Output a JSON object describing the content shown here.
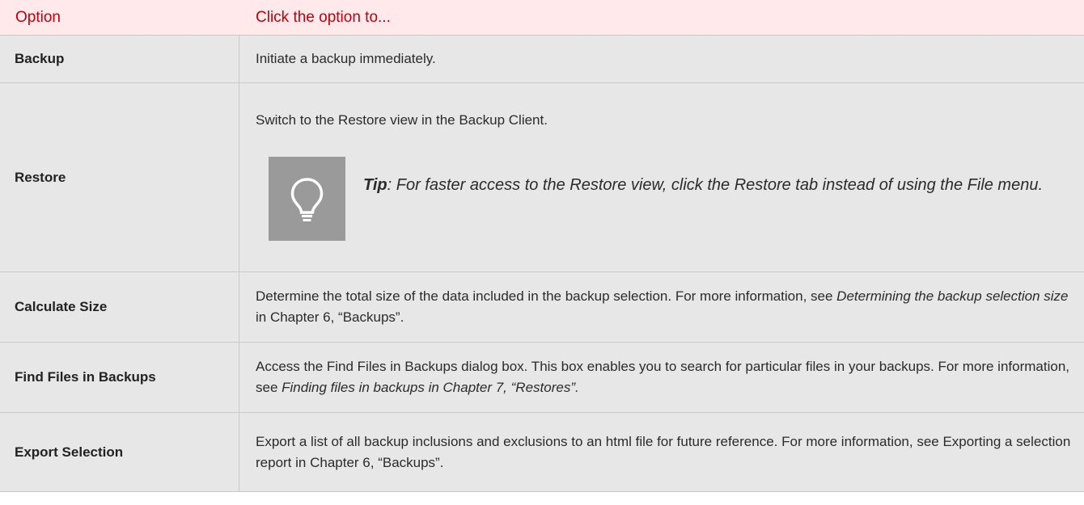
{
  "header": {
    "col1": "Option",
    "col2": "Click the option to..."
  },
  "rows": [
    {
      "option": "Backup",
      "desc": "Initiate a backup immediately."
    },
    {
      "option": "Restore",
      "desc": "Switch to the Restore view in the Backup Client.",
      "tip": {
        "icon": "lightbulb-icon",
        "label": "Tip",
        "text": ": For faster access to the Restore view, click the Restore tab instead of using the File menu."
      }
    },
    {
      "option": "Calculate Size",
      "desc_a": "Determine the total size of the data included in the backup selection. For more information, see ",
      "desc_italic": "Determining the backup selection size",
      "desc_b": " in Chapter 6, “Backups”."
    },
    {
      "option": "Find Files in Backups",
      "desc_a": "Access the Find Files in Backups dialog box. This box enables you to search for particular files in your backups. For more information, see ",
      "desc_italic": "Finding files in backups in Chapter 7, “Restores”."
    },
    {
      "option": "Export Selection",
      "desc": "Export a list of all backup inclusions and exclusions to an html file for future reference. For more information, see Exporting a selection report in Chapter 6, “Backups”."
    }
  ],
  "colors": {
    "header_bg": "#ffe9ea",
    "header_text": "#c0000c",
    "row_bg": "#e7e7e7",
    "tip_box": "#9a9a9a"
  }
}
